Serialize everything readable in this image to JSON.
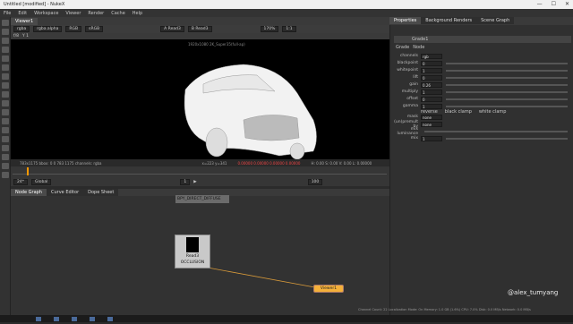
{
  "app": {
    "title": "Untitled [modified] - NukeX"
  },
  "menu": [
    "File",
    "Edit",
    "Workspace",
    "Viewer",
    "Render",
    "Cache",
    "Help"
  ],
  "viewer": {
    "tab": "Viewer1",
    "channels": "rgba",
    "channel_mode": "rgba.alpha",
    "colorspace": "RGB",
    "display": "sRGB",
    "input_a": "A  Read3",
    "input_b": "B  Read3",
    "zoom": "170%",
    "ratio": "1:1",
    "format": "1920x1080  2K_Super35(full-ap)",
    "info_left": "783x1175  bbox: 0 0 783 1175 channels: rgba",
    "info_coords": "x=223 y=341",
    "info_vals": "0.00000  0.00000  0.00000  0.00000",
    "info_right": "H: 0.00  S: 0.00  V: 0.00  L: 0.00000"
  },
  "timeline": {
    "ticks": [
      "1",
      "13",
      "20",
      "31",
      "40",
      "50",
      "60",
      "70",
      "80",
      "90",
      "100"
    ],
    "fps": "24*",
    "mode": "Global",
    "frame": "1",
    "end": "100"
  },
  "dag": {
    "tabs": [
      "Node Graph",
      "Curve Editor",
      "Dope Sheet"
    ],
    "backdrop": "BPY_DIRECT_DIFFUSE",
    "read_node": "Read3",
    "read_sub": "OCCLUSION",
    "viewer_node": "Viewer1"
  },
  "props": {
    "tabs": [
      "Properties",
      "Background Renders",
      "Scene Graph"
    ],
    "node": "Grade1",
    "subtabs": [
      "Grade",
      "Node"
    ],
    "channels": "rgb",
    "rows": [
      {
        "label": "blackpoint",
        "val": "0"
      },
      {
        "label": "whitepoint",
        "val": "1"
      },
      {
        "label": "lift",
        "val": "0"
      },
      {
        "label": "gain",
        "val": "0.26"
      },
      {
        "label": "multiply",
        "val": "1"
      },
      {
        "label": "offset",
        "val": "0"
      },
      {
        "label": "gamma",
        "val": "1"
      }
    ],
    "reverse": "reverse",
    "black_clamp": "black clamp",
    "white_clamp": "white clamp",
    "mask": "mask",
    "mask_val": "none",
    "unpremult": "(un)premult by",
    "unpremult_val": "none",
    "mix_lum": "mix luminance",
    "mix": "mix",
    "mix_val": "1"
  },
  "watermark": "@alex_tumyang",
  "status": "Channel Count: 22  Localization Mode: On  Memory: 1.0 GB (1.6%)  CPU: 7.0%  Disk: 0.0 MB/s  Network: 0.0 MB/s"
}
